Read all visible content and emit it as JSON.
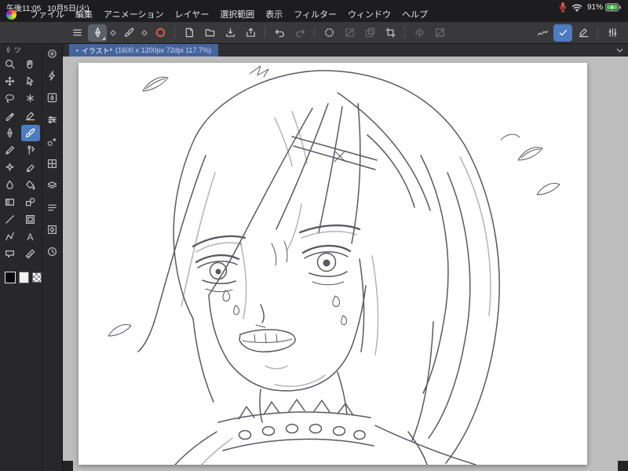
{
  "colors": {
    "accent-blue": "#4d7cc0",
    "tab-blue": "#45639d",
    "mic-red": "#e0503f",
    "battery-green": "#55c95f",
    "canvas-bg": "#bdbdbd",
    "pencil": "#43434e",
    "toolbar-bg": "#39393c",
    "sidebar-bg": "#28282a",
    "statusbar-bg": "#1d1d1f"
  },
  "status_bar": {
    "time": "午後11:05",
    "date": "10月5日(火)",
    "battery": "91%",
    "icons": [
      "mic-icon",
      "wifi-icon",
      "battery-icon"
    ]
  },
  "menu_bar": {
    "logo_icon": "clip-studio-logo",
    "items": [
      "ファイル",
      "編集",
      "アニメーション",
      "レイヤー",
      "選択範囲",
      "表示",
      "フィルター",
      "ウィンドウ",
      "ヘルプ"
    ]
  },
  "toolbar": {
    "icons": [
      "hamburger-menu",
      "current-tool-pen",
      "expander-diamond",
      "current-subtool-marker",
      "expander-diamond",
      "clip-studio-home",
      "new-canvas",
      "open-file",
      "save",
      "share",
      "undo",
      "redo",
      "selection-launcher",
      "deselect",
      "select-layer",
      "crop",
      "flip-horizontal",
      "reference-layer",
      "smoothing",
      "stabilizer",
      "vector-correction",
      "palette-settings"
    ]
  },
  "document_tab": {
    "unsaved_dot": "•",
    "title": "イラスト*",
    "meta": "(1600 x 1200px 72dpi 117.7%)"
  },
  "tool_palette": {
    "header": "ツ",
    "text_tool_glyph": "A",
    "tools": [
      "zoom",
      "hand",
      "move",
      "operation",
      "lasso",
      "auto-select",
      "eyedropper",
      "correct-line",
      "pen",
      "brush",
      "pencil",
      "airbrush",
      "decoration",
      "eraser",
      "blend",
      "fill",
      "gradient",
      "figure",
      "line",
      "frame",
      "polygon",
      "text",
      "balloon",
      "ruler"
    ],
    "selected_tool": "brush",
    "swatches": {
      "main": "#000000",
      "sub": "#ffffff",
      "third": "transparent",
      "selected": "main"
    }
  },
  "palette_strip": {
    "icons": [
      "navigator-icon",
      "quick-access-icon",
      "sub-tool-icon",
      "tool-property-icon",
      "brush-size-icon",
      "color-set-icon",
      "layer-icon",
      "layer-property-icon",
      "material-icon",
      "history-icon"
    ]
  },
  "canvas": {
    "content": "rough pencil sketch: worried anime character with long flowing hair, furrowed brows, sweat drops, open grimacing mouth and a spiked studded collar; small leaf doodles around"
  }
}
